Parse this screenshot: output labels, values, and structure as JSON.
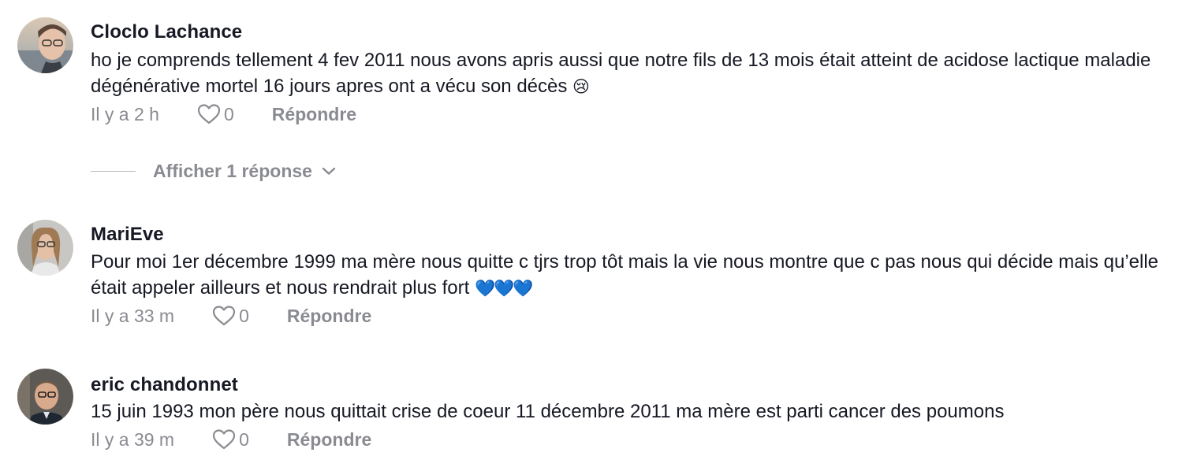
{
  "comments": [
    {
      "author": "Cloclo Lachance",
      "text": "ho je comprends tellement 4 fev 2011 nous avons apris aussi que notre fils de 13 mois était atteint de acidose lactique maladie dégénérative mortel 16 jours apres ont a vécu son décès",
      "emoji": "😢",
      "timestamp": "Il y a 2 h",
      "likes": "0",
      "reply_label": "Répondre",
      "view_replies_label": "Afficher 1 réponse"
    },
    {
      "author": "MariEve",
      "text": "Pour moi 1er décembre 1999 ma mère nous quitte c tjrs trop tôt mais la vie nous montre que c pas nous qui décide mais qu’elle était appeler ailleurs et nous rendrait plus fort",
      "emoji": "💙💙💙",
      "timestamp": "Il y a 33 m",
      "likes": "0",
      "reply_label": "Répondre"
    },
    {
      "author": "eric chandonnet",
      "text": "15 juin 1993 mon père nous quittait crise de coeur 11 décembre 2011 ma mère est parti cancer des poumons",
      "timestamp": "Il y a 39 m",
      "likes": "0",
      "reply_label": "Répondre"
    }
  ],
  "icons": {
    "like": "heart-outline-icon",
    "expand": "chevron-down-icon"
  },
  "colors": {
    "text": "#161823",
    "muted": "#8a8b91",
    "emoji_heart": "#2f86f0"
  }
}
